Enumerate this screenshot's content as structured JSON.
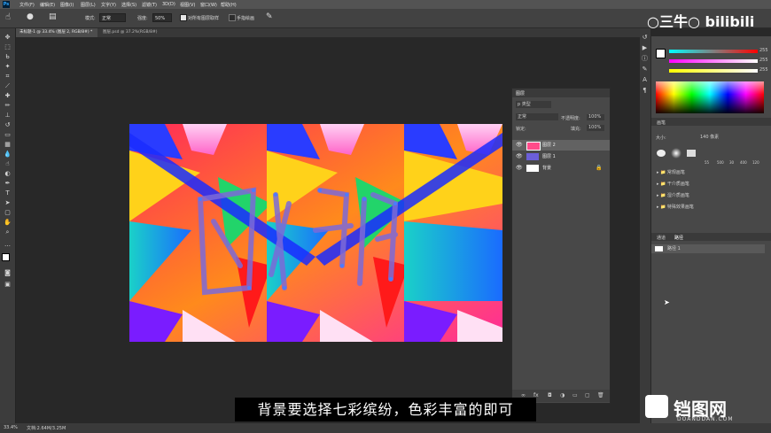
{
  "menu": {
    "logo": "Ps",
    "items": [
      "文件(F)",
      "编辑(E)",
      "图像(I)",
      "图层(L)",
      "文字(Y)",
      "选择(S)",
      "滤镜(T)",
      "3D(D)",
      "视图(V)",
      "窗口(W)",
      "帮助(H)"
    ]
  },
  "options": {
    "mode_label": "模式:",
    "mode_value": "正常",
    "opacity_label": "强度:",
    "opacity_value": "50%",
    "sample_all": "对所有图层取样",
    "finger": "手指绘画"
  },
  "tabs": [
    {
      "label": "未标题-1 @ 33.4% (图层 2, RGB/8#) *"
    },
    {
      "label": "图层.psd @ 37.2%(RGB/8#)"
    }
  ],
  "branding": {
    "text": "○三牛○ bilibili"
  },
  "layers_panel": {
    "title": "图层",
    "kind_label": "p 类型",
    "blend": "正常",
    "opacity_label": "不透明度:",
    "opacity": "100%",
    "lock_label": "锁定:",
    "fill_label": "填充:",
    "fill": "100%",
    "layers": [
      {
        "name": "图层 2"
      },
      {
        "name": "图层 1"
      },
      {
        "name": "背景"
      }
    ]
  },
  "color_panel": {
    "r": "255",
    "g": "255",
    "b": "255"
  },
  "brush_panel": {
    "title": "画笔",
    "size_label": "大小:",
    "size_value": "140 像素",
    "sizes": [
      "55",
      "500",
      "30",
      "400",
      "120"
    ],
    "folders": [
      "常规画笔",
      "干介质画笔",
      "湿介质画笔",
      "特殊效果画笔"
    ]
  },
  "paths_panel": {
    "tabs": [
      "通道",
      "路径"
    ],
    "item": "路径 1"
  },
  "status": {
    "zoom": "33.4%",
    "doc": "文档:2.64M/3.25M"
  },
  "subtitle": "背景要选择七彩缤纷，色彩丰富的即可",
  "watermark": {
    "main": "铛图网",
    "sub": "DOANDDAN.COM"
  }
}
